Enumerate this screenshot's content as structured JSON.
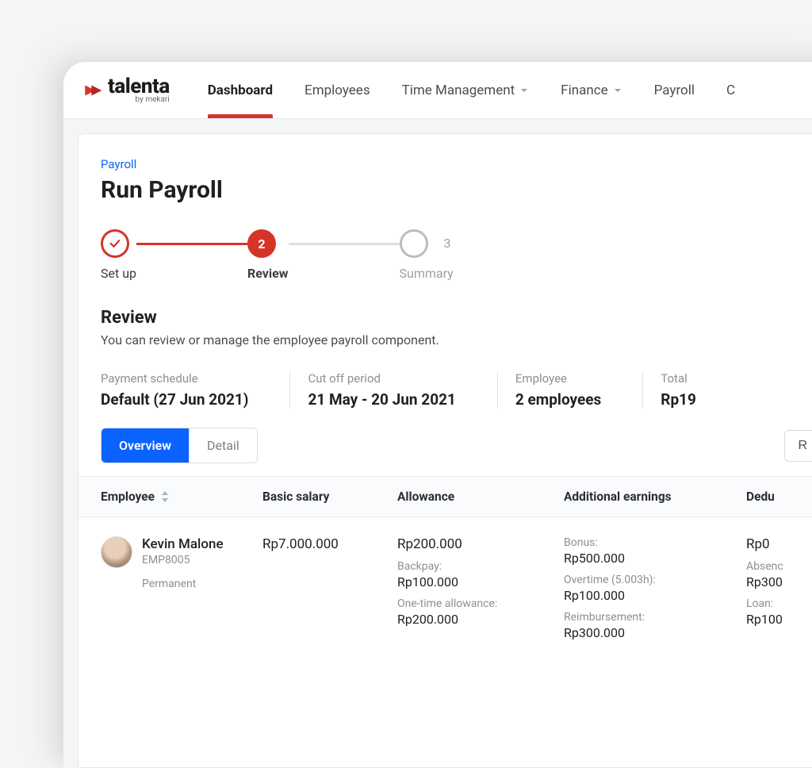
{
  "logo": {
    "text": "talenta",
    "sub": "by mekari"
  },
  "nav": {
    "items": [
      {
        "label": "Dashboard",
        "active": true,
        "hasDropdown": false
      },
      {
        "label": "Employees",
        "active": false,
        "hasDropdown": false
      },
      {
        "label": "Time Management",
        "active": false,
        "hasDropdown": true
      },
      {
        "label": "Finance",
        "active": false,
        "hasDropdown": true
      },
      {
        "label": "Payroll",
        "active": false,
        "hasDropdown": false
      },
      {
        "label": "C",
        "active": false,
        "hasDropdown": false
      }
    ]
  },
  "breadcrumb": "Payroll",
  "pageTitle": "Run Payroll",
  "stepper": {
    "steps": [
      {
        "label": "Set up",
        "state": "done"
      },
      {
        "label": "Review",
        "state": "active",
        "num": "2"
      },
      {
        "label": "Summary",
        "state": "pending",
        "num": "3"
      }
    ]
  },
  "review": {
    "title": "Review",
    "description": "You can review or manage the employee payroll component."
  },
  "info": {
    "cells": [
      {
        "label": "Payment schedule",
        "value": "Default (27 Jun 2021)"
      },
      {
        "label": "Cut off period",
        "value": "21 May - 20 Jun 2021"
      },
      {
        "label": "Employee",
        "value": "2 employees"
      },
      {
        "label": "Total",
        "value": "Rp19"
      }
    ]
  },
  "tabs": {
    "overview": "Overview",
    "detail": "Detail",
    "rightButton": "R"
  },
  "table": {
    "headers": {
      "employee": "Employee",
      "basicSalary": "Basic salary",
      "allowance": "Allowance",
      "additional": "Additional earnings",
      "deduction": "Dedu"
    },
    "rows": [
      {
        "name": "Kevin Malone",
        "empId": "EMP8005",
        "type": "Permanent",
        "basicSalary": "Rp7.000.000",
        "allowance": {
          "primary": "Rp200.000",
          "items": [
            {
              "label": "Backpay:",
              "value": "Rp100.000"
            },
            {
              "label": "One-time allowance:",
              "value": "Rp200.000"
            }
          ]
        },
        "additional": {
          "items": [
            {
              "label": "Bonus:",
              "value": "Rp500.000"
            },
            {
              "label": "Overtime (5.003h):",
              "value": "Rp100.000"
            },
            {
              "label": "Reimbursement:",
              "value": "Rp300.000"
            }
          ]
        },
        "deduction": {
          "primary": "Rp0",
          "items": [
            {
              "label": "Absenc",
              "value": "Rp300"
            },
            {
              "label": "Loan:",
              "value": "Rp100"
            }
          ]
        }
      }
    ]
  }
}
